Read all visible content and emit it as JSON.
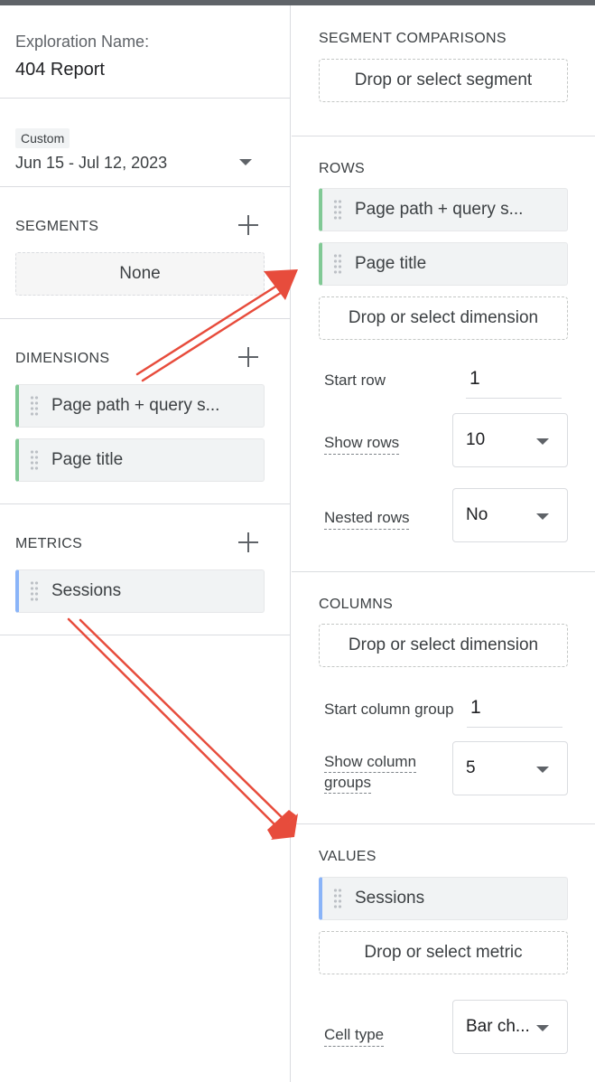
{
  "left": {
    "exploration_label": "Exploration Name:",
    "exploration_name": "404 Report",
    "date_badge": "Custom",
    "date_range": "Jun 15 - Jul 12, 2023",
    "segments_header": "SEGMENTS",
    "segments_value": "None",
    "dimensions_header": "DIMENSIONS",
    "dimensions": [
      "Page path + query s...",
      "Page title"
    ],
    "metrics_header": "METRICS",
    "metrics": [
      "Sessions"
    ]
  },
  "right": {
    "segment_comparisons_header": "SEGMENT COMPARISONS",
    "segment_drop": "Drop or select segment",
    "rows_header": "ROWS",
    "rows": [
      "Page path + query s...",
      "Page title"
    ],
    "rows_drop": "Drop or select dimension",
    "start_row_label": "Start row",
    "start_row_value": "1",
    "show_rows_label": "Show rows",
    "show_rows_value": "10",
    "nested_rows_label": "Nested rows",
    "nested_rows_value": "No",
    "columns_header": "COLUMNS",
    "columns_drop": "Drop or select dimension",
    "start_column_group_label": "Start column group",
    "start_column_group_value": "1",
    "show_column_groups_label_line1": "Show column",
    "show_column_groups_label_line2": "groups",
    "show_column_groups_value": "5",
    "values_header": "VALUES",
    "values": [
      "Sessions"
    ],
    "values_drop": "Drop or select metric",
    "cell_type_label": "Cell type",
    "cell_type_value": "Bar ch..."
  },
  "colors": {
    "dimension_accent": "#81c995",
    "metric_accent": "#8ab4f8",
    "annotation_arrow": "#e74c3c"
  }
}
